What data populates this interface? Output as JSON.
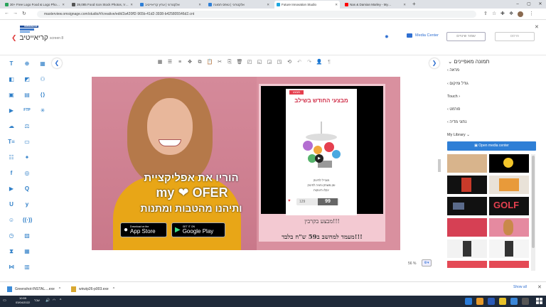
{
  "browser": {
    "tabs": [
      {
        "title": "30+ Free Logo Food & Logo Pho…",
        "color": "#2aa35b"
      },
      {
        "title": "39,085 Food Icon Stock Photos, V…",
        "color": "#555555"
      },
      {
        "title": "אלקטרוני | ערוץ קריאייטיב",
        "color": "#2f7fd6"
      },
      {
        "title": "אלקטרוני | טופס תמונה",
        "color": "#2f7fd6"
      },
      {
        "title": "Future Innovation Studio",
        "color": "#1ea7e0"
      },
      {
        "title": "Nas & Damian Marley - My…",
        "color": "#ff0000"
      }
    ],
    "url": "masterview.omsignage.com/studio/#/creative/edit/2a420ff2-965b-41d2-3938-b425805546d2.cnt",
    "tab_close": "✕",
    "new_tab": "+"
  },
  "header": {
    "title": "קריאייטיב",
    "screen_label": "screen 8",
    "logo_text": "OMSIGNAGE",
    "media_center": "Media Center",
    "save_label": "שמור שינויים",
    "publish_label": "פרסם"
  },
  "canvas": {
    "promo_line1": "הוריו את אפליקציית",
    "promo_brand_a": "my",
    "promo_brand_b": "OFER",
    "promo_line3": "ותיהנו מהטבות ומתנות",
    "app_store_small": "Download on the",
    "app_store_big": "App Store",
    "gplay_small": "GET IT ON",
    "gplay_big": "Google Play",
    "video_badge": "מבצע",
    "video_title": "מבצעי החודש בשילב",
    "video_line1": "מובייל לתינוק",
    "video_line2": "זמן משחק וחוויה לתינוק",
    "video_line3": "ינקלו תינוקות",
    "price_old": "129",
    "price_new": "99",
    "caption1": "מבצע בקרבין!!!",
    "caption2": "מעמד למחשב ב59 ש\"ח בלבד!!!"
  },
  "zoom": {
    "value": "56 %"
  },
  "right_panel": {
    "title": "תמונה מאפיינים",
    "items": [
      "מראה",
      "גודל ומיקום",
      "Touch",
      "פורמט",
      "נתוני מדיה"
    ],
    "library": "My Library",
    "open_media": "Open media center",
    "thumbs": [
      {
        "color": "#d8b48c",
        "label": ""
      },
      {
        "color": "#000000",
        "label": ""
      },
      {
        "color": "#111111",
        "label": ""
      },
      {
        "color": "#e9e2d8",
        "label": ""
      },
      {
        "color": "#111111",
        "label": ""
      },
      {
        "color": "#111111",
        "label": "GOLF"
      },
      {
        "color": "#d64054",
        "label": ""
      },
      {
        "color": "#e58aa0",
        "label": ""
      },
      {
        "color": "#f2f2f2",
        "label": ""
      },
      {
        "color": "#f5f5f5",
        "label": ""
      },
      {
        "color": "#e44a55",
        "label": ""
      },
      {
        "color": "#e44a55",
        "label": ""
      }
    ]
  },
  "downloads": {
    "items": [
      "Greenshot-INSTAL....exe",
      "winzip26-p003.exe"
    ],
    "show_all": "Show all"
  },
  "taskbar": {
    "time": "10:59",
    "date": "03/04/2022",
    "lang": "עבר"
  }
}
